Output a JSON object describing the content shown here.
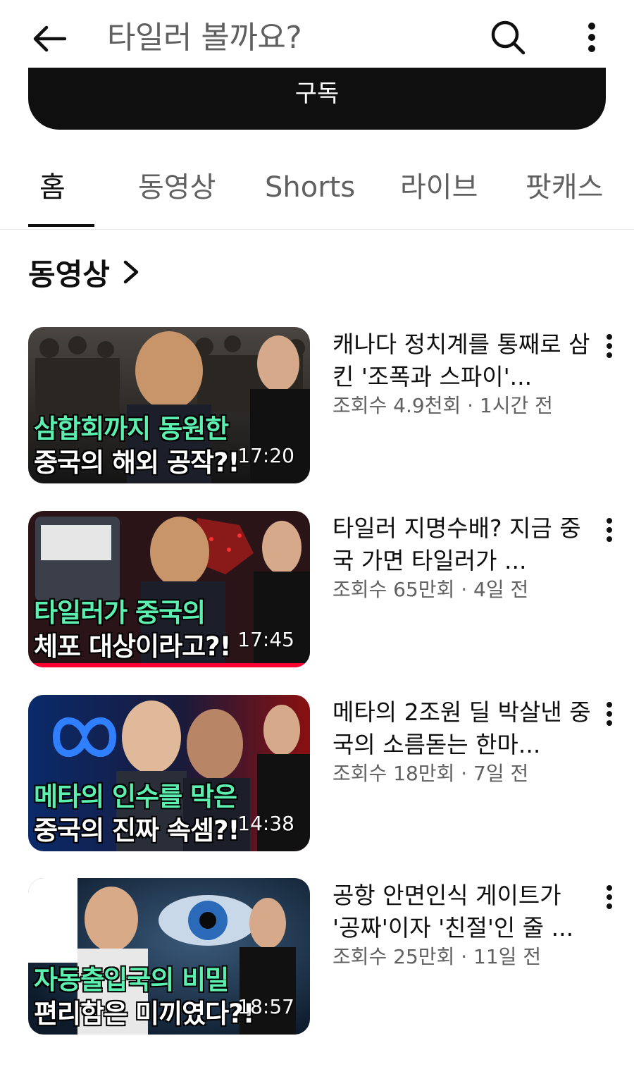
{
  "header": {
    "search_query": "타일러 볼까요?"
  },
  "subscribe": {
    "label": "구독"
  },
  "tabs": [
    {
      "label": "홈",
      "active": true
    },
    {
      "label": "동영상",
      "active": false
    },
    {
      "label": "Shorts",
      "active": false
    },
    {
      "label": "라이브",
      "active": false
    },
    {
      "label": "팟캐스",
      "active": false
    }
  ],
  "section": {
    "title": "동영상"
  },
  "videos": [
    {
      "title": "캐나다 정치계를 통째로 삼킨 '조폭과 스파이'...",
      "stats": "조회수 4.9천회 · 1시간 전",
      "duration": "17:20",
      "thumb_line1": "삼합회까지 동원한",
      "thumb_line2": "중국의 해외 공작?!",
      "watched": false
    },
    {
      "title": "타일러 지명수배? 지금 중국 가면 타일러가 ...",
      "stats": "조회수 65만회 · 4일 전",
      "duration": "17:45",
      "thumb_line1": "타일러가 중국의",
      "thumb_line2": "체포 대상이라고?!",
      "watched": true
    },
    {
      "title": "메타의 2조원 딜 박살낸 중국의 소름돋는 한마...",
      "stats": "조회수 18만회 · 7일 전",
      "duration": "14:38",
      "thumb_line1": "메타의 인수를 막은",
      "thumb_line2": "중국의 진짜 속셈?!",
      "watched": false
    },
    {
      "title": "공항 안면인식 게이트가 '공짜'이자 '친절'인 줄 ...",
      "stats": "조회수 25만회 · 11일 전",
      "duration": "18:57",
      "thumb_line1": "자동출입국의 비밀",
      "thumb_line2": "편리함은 미끼였다?!",
      "watched": false
    }
  ],
  "colors": {
    "caption_green": "#5cf0b0",
    "progress_red": "#ff0033",
    "text_primary": "#0f0f0f",
    "text_secondary": "#606060"
  }
}
